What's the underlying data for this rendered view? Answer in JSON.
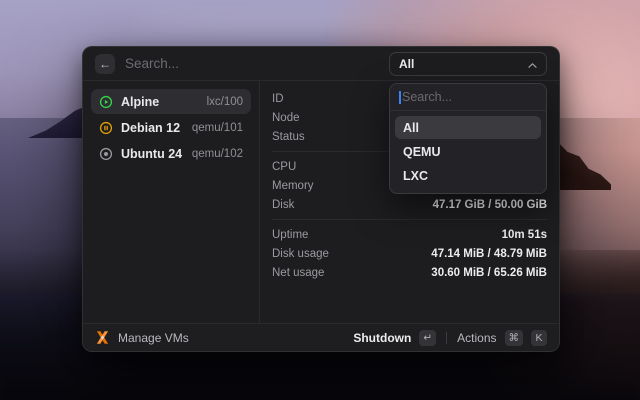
{
  "window": {
    "search": {
      "placeholder": "Search..."
    },
    "filter_button": {
      "selected": "All"
    },
    "vm_list": [
      {
        "name": "Alpine",
        "id": "lxc/100",
        "status": "running",
        "selected": true
      },
      {
        "name": "Debian 12",
        "id": "qemu/101",
        "status": "paused",
        "selected": false
      },
      {
        "name": "Ubuntu 24",
        "id": "qemu/102",
        "status": "stopped",
        "selected": false
      }
    ],
    "details": {
      "sections": [
        [
          {
            "label": "ID",
            "value": ""
          },
          {
            "label": "Node",
            "value": ""
          },
          {
            "label": "Status",
            "value": ""
          }
        ],
        [
          {
            "label": "CPU",
            "value": ""
          },
          {
            "label": "Memory",
            "value": ""
          },
          {
            "label": "Disk",
            "value": "47.17 GiB / 50.00 GiB"
          }
        ],
        [
          {
            "label": "Uptime",
            "value": "10m 51s"
          },
          {
            "label": "Disk usage",
            "value": "47.14 MiB / 48.79 MiB"
          },
          {
            "label": "Net usage",
            "value": "30.60 MiB / 65.26 MiB"
          }
        ]
      ]
    },
    "dropdown": {
      "search_placeholder": "Search...",
      "options": [
        {
          "label": "All",
          "selected": true
        },
        {
          "label": "QEMU",
          "selected": false
        },
        {
          "label": "LXC",
          "selected": false
        }
      ]
    },
    "footer": {
      "app_name": "Manage VMs",
      "primary_action": "Shutdown",
      "primary_key": "↵",
      "actions_label": "Actions",
      "actions_keys": [
        "⌘",
        "K"
      ]
    },
    "icons": {
      "back": "←"
    },
    "colors": {
      "running_green": "#32d74b",
      "paused_amber": "#e3a008",
      "stopped_gray": "#98989d",
      "logo_orange": "#e57000",
      "caret_blue": "#3c82f7"
    }
  }
}
